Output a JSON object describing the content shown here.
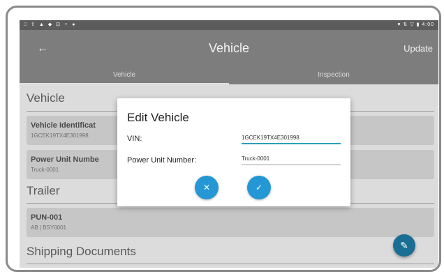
{
  "status_bar": {
    "left_icons": "□ ⇧ ▲ ◆ ⊡ ♆ ●",
    "right_text": "♥ ⇅ ▽ ▮ 4:00"
  },
  "app_bar": {
    "back_icon": "←",
    "title": "Vehicle",
    "action_label": "Update"
  },
  "tabs": [
    {
      "label": "Vehicle",
      "selected": true
    },
    {
      "label": "Inspection",
      "selected": false
    }
  ],
  "sections": {
    "vehicle": {
      "header": "Vehicle",
      "cards": [
        {
          "title": "Vehicle Identificat",
          "subtitle": "1GCEK19TX4E301998"
        },
        {
          "title": "Power Unit Numbe",
          "subtitle": "Truck-0001"
        }
      ]
    },
    "trailer": {
      "header": "Trailer",
      "cards": [
        {
          "title": "PUN-001",
          "subtitle": "AB | BSY0001"
        }
      ]
    },
    "shipping": {
      "header": "Shipping Documents"
    }
  },
  "fab": {
    "icon": "pencil-icon",
    "glyph": "✎"
  },
  "dialog": {
    "title": "Edit Vehicle",
    "vin_label": "VIN:",
    "vin_value": "1GCEK19TX4E301998",
    "pun_label": "Power Unit Number:",
    "pun_value": "Truck-0001",
    "cancel_glyph": "✕",
    "confirm_glyph": "✓"
  },
  "colors": {
    "accent_button": "#2497d4",
    "fab": "#1a6e93",
    "app_bar": "#7d7d7d",
    "focused_underline": "#2a9fb8"
  }
}
